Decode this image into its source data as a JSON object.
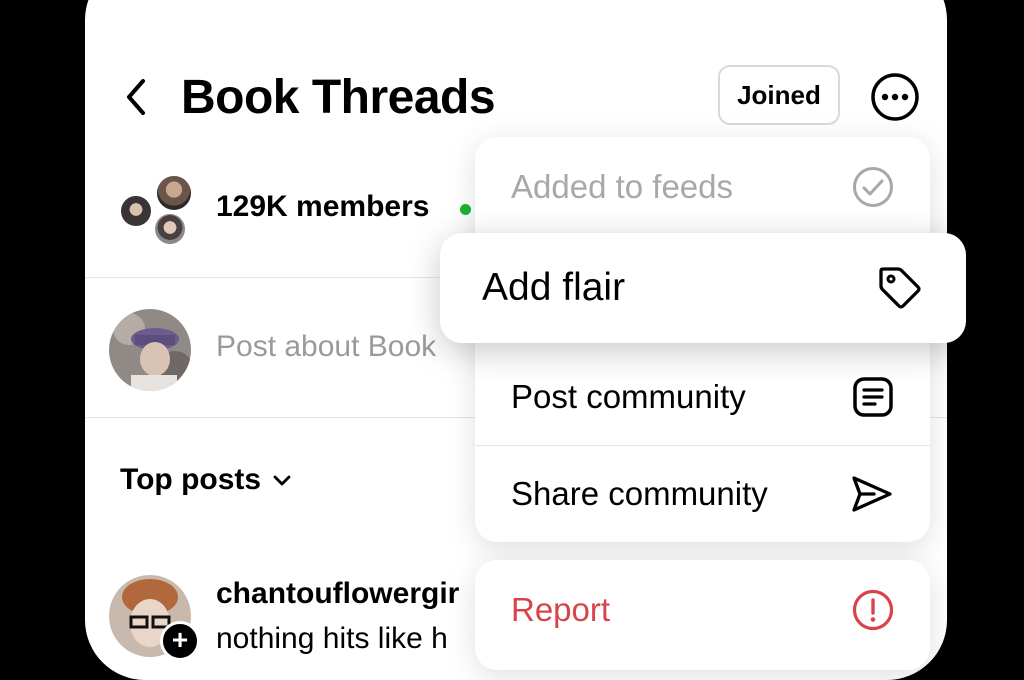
{
  "header": {
    "title": "Book Threads",
    "joined_label": "Joined"
  },
  "community": {
    "members": "129K members"
  },
  "composer": {
    "placeholder": "Post about Book"
  },
  "feed": {
    "sort_label": "Top posts",
    "post": {
      "author": "chantouflowergir",
      "snippet": "nothing hits like h"
    }
  },
  "menu": {
    "added_to_feeds": "Added to feeds",
    "add_flair": "Add flair",
    "post_community": "Post community",
    "share_community": "Share community",
    "report": "Report"
  },
  "colors": {
    "online": "#1db33a",
    "danger": "#d9434b",
    "muted": "#9a9a9a"
  }
}
